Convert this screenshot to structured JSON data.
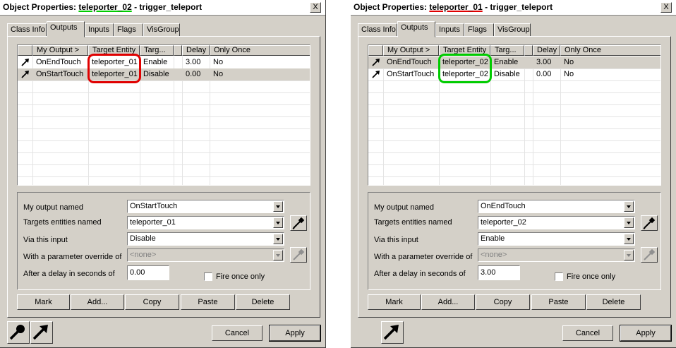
{
  "colors": {
    "highlight_red": "#e00000",
    "highlight_green": "#00cc00"
  },
  "left": {
    "title_prefix": "Object Properties:",
    "title_entity": "teleporter_02",
    "title_suffix": "- trigger_teleport",
    "title_underline_color": "#00cc00",
    "close_label": "X",
    "tabs": [
      "Class Info",
      "Outputs",
      "Inputs",
      "Flags",
      "VisGroup"
    ],
    "columns": [
      "My Output >",
      "Target Entity",
      "Targ...",
      "",
      "Delay",
      "Only Once"
    ],
    "rows": [
      {
        "output": "OnEndTouch",
        "target": "teleporter_01",
        "input": "Enable",
        "delay": "3.00",
        "once": "No"
      },
      {
        "output": "OnStartTouch",
        "target": "teleporter_01",
        "input": "Disable",
        "delay": "0.00",
        "once": "No"
      }
    ],
    "selected_row": 1,
    "highlight_color": "#e00000",
    "labels": {
      "output": "My output named",
      "targets": "Targets entities named",
      "via": "Via this input",
      "param": "With a parameter override of",
      "delay": "After a delay in seconds of"
    },
    "fields": {
      "output": "OnStartTouch",
      "targets": "teleporter_01",
      "via": "Disable",
      "param": "<none>",
      "delay": "0.00"
    },
    "fire_once_label": "Fire once only",
    "buttons": [
      "Mark",
      "Add...",
      "Copy",
      "Paste",
      "Delete"
    ],
    "cancel_label": "Cancel",
    "apply_label": "Apply"
  },
  "right": {
    "title_prefix": "Object Properties:",
    "title_entity": "teleporter_01",
    "title_suffix": "- trigger_teleport",
    "title_underline_color": "#e00000",
    "close_label": "X",
    "tabs": [
      "Class Info",
      "Outputs",
      "Inputs",
      "Flags",
      "VisGroup"
    ],
    "columns": [
      "My Output >",
      "Target Entity",
      "Targ...",
      "",
      "Delay",
      "Only Once"
    ],
    "rows": [
      {
        "output": "OnEndTouch",
        "target": "teleporter_02",
        "input": "Enable",
        "delay": "3.00",
        "once": "No"
      },
      {
        "output": "OnStartTouch",
        "target": "teleporter_02",
        "input": "Disable",
        "delay": "0.00",
        "once": "No"
      }
    ],
    "selected_row": 0,
    "highlight_color": "#00cc00",
    "labels": {
      "output": "My output named",
      "targets": "Targets entities named",
      "via": "Via this input",
      "param": "With a parameter override of",
      "delay": "After a delay in seconds of"
    },
    "fields": {
      "output": "OnEndTouch",
      "targets": "teleporter_02",
      "via": "Enable",
      "param": "<none>",
      "delay": "3.00"
    },
    "fire_once_label": "Fire once only",
    "buttons": [
      "Mark",
      "Add...",
      "Copy",
      "Paste",
      "Delete"
    ],
    "cancel_label": "Cancel",
    "apply_label": "Apply"
  }
}
